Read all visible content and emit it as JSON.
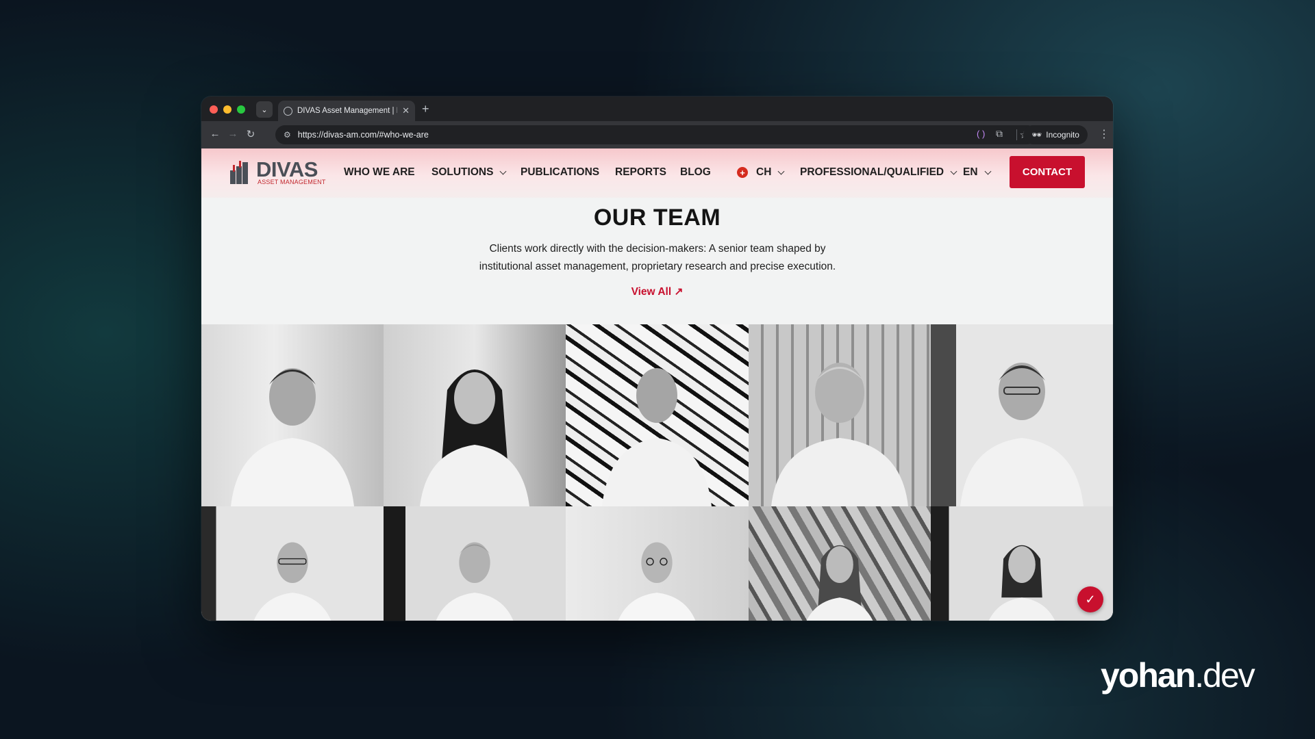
{
  "browser": {
    "tab_title": "DIVAS Asset Management | In",
    "tab_close": "✕",
    "new_tab": "+",
    "url": "https://divas-am.com/#who-we-are",
    "incognito_label": "Incognito",
    "icons": [
      "back-arrow-icon",
      "forward-arrow-icon",
      "reload-icon",
      "site-settings-icon",
      "bookmark-star-icon",
      "extension-icon",
      "incognito-icon",
      "menu-dots-icon"
    ]
  },
  "site": {
    "logo_text": "DIVAS",
    "logo_subtitle": "ASSET MANAGEMENT",
    "nav": {
      "who_we_are": "WHO WE ARE",
      "solutions": "SOLUTIONS",
      "publications": "PUBLICATIONS",
      "reports": "REPORTS",
      "blog": "BLOG",
      "country": "CH",
      "investor_type": "PROFESSIONAL/QUALIFIED",
      "language": "EN",
      "contact": "CONTACT"
    },
    "team": {
      "title": "OUR TEAM",
      "description": "Clients work directly with the decision-makers: A senior team shaped by institutional asset management, proprietary research and precise execution.",
      "view_all": "View All ↗"
    },
    "accent_color": "#c8102e"
  },
  "watermark": {
    "brand_bold": "yohan",
    "brand_light": ".dev"
  }
}
